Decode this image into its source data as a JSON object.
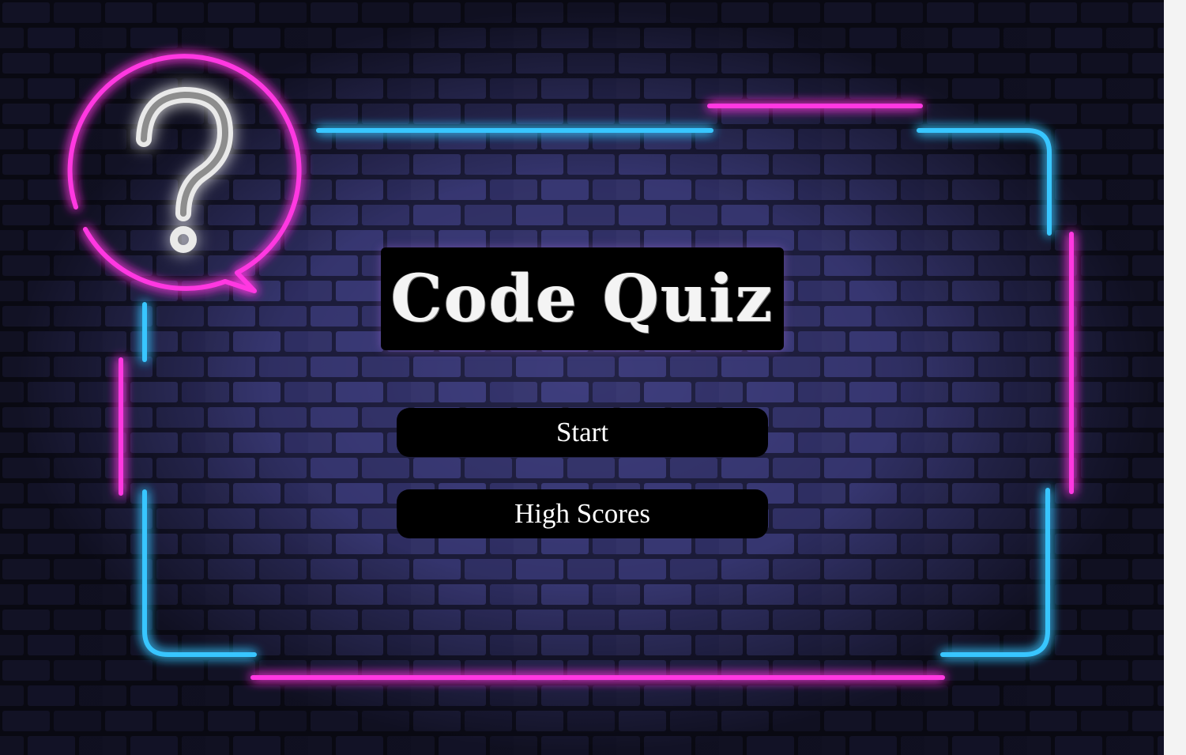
{
  "app": {
    "title": "Code Quiz"
  },
  "menu": {
    "start_label": "Start",
    "high_scores_label": "High Scores"
  },
  "decor": {
    "logo_icon": "question-bubble-icon",
    "frame": "neon-frame",
    "background": "brick-wall"
  },
  "colors": {
    "neon_pink": "#ff2bd6",
    "neon_blue": "#2ec8ff",
    "button_bg": "#000000",
    "text": "#ffffff"
  }
}
